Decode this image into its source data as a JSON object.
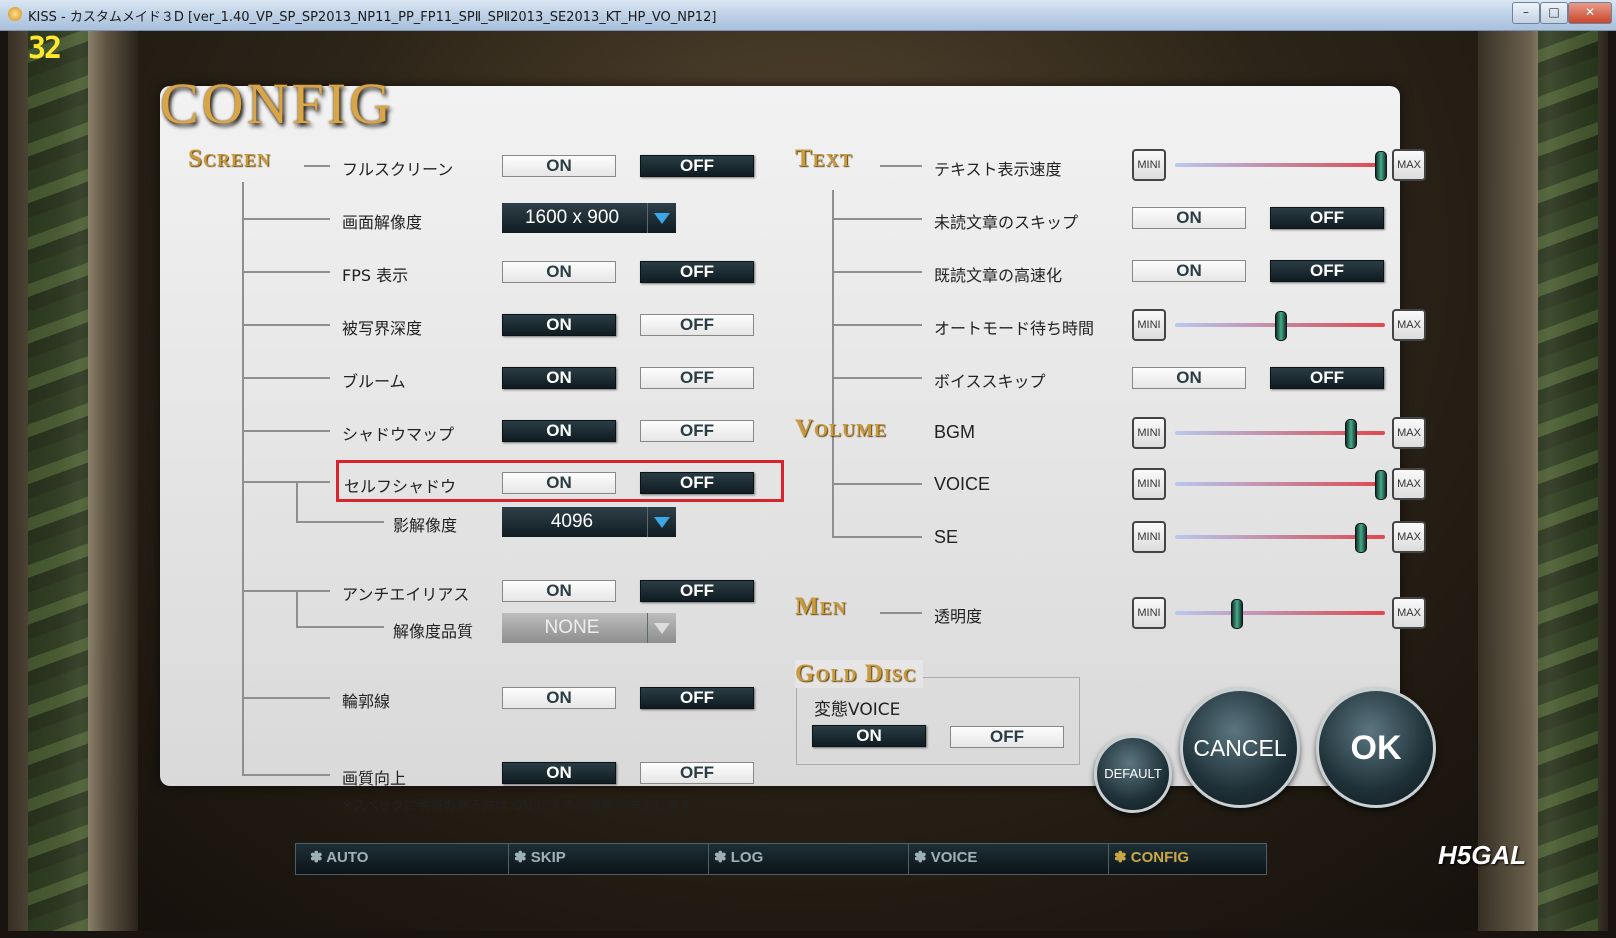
{
  "window": {
    "title": "KISS - カスタムメイド３D [ver_1.40_VP_SP_SP2013_NP11_PP_FP11_SPⅡ_SPⅡ2013_SE2013_KT_HP_VO_NP12]"
  },
  "fps": "32",
  "config_title": "CONFIG",
  "screen": {
    "section": "Screen",
    "fullscreen": {
      "label": "フルスクリーン",
      "on": "ON",
      "off": "OFF"
    },
    "resolution": {
      "label": "画面解像度",
      "value": "1600 x 900"
    },
    "fps_display": {
      "label": "FPS 表示",
      "on": "ON",
      "off": "OFF"
    },
    "depth_of_field": {
      "label": "被写界深度",
      "on": "ON",
      "off": "OFF"
    },
    "bloom": {
      "label": "ブルーム",
      "on": "ON",
      "off": "OFF"
    },
    "shadow_map": {
      "label": "シャドウマップ",
      "on": "ON",
      "off": "OFF"
    },
    "self_shadow": {
      "label": "セルフシャドウ",
      "on": "ON",
      "off": "OFF"
    },
    "shadow_resolution": {
      "label": "影解像度",
      "value": "4096"
    },
    "antialias": {
      "label": "アンチエイリアス",
      "on": "ON",
      "off": "OFF"
    },
    "aa_quality": {
      "label": "解像度品質",
      "value": "NONE"
    },
    "outline": {
      "label": "輪郭線",
      "on": "ON",
      "off": "OFF"
    },
    "quality_up": {
      "label": "画質向上",
      "on": "ON",
      "off": "OFF",
      "note": "※スペックに余裕のある方は ON にすると画質が向上します。"
    }
  },
  "text": {
    "section": "Text",
    "speed": {
      "label": "テキスト表示速度",
      "min": "MINI",
      "max": "MAX",
      "level": 1.0
    },
    "skip_unread": {
      "label": "未読文章のスキップ",
      "on": "ON",
      "off": "OFF"
    },
    "fast_read": {
      "label": "既読文章の高速化",
      "on": "ON",
      "off": "OFF"
    },
    "auto_wait": {
      "label": "オートモード待ち時間",
      "min": "MINI",
      "max": "MAX",
      "level": 0.5
    },
    "voice_skip": {
      "label": "ボイススキップ",
      "on": "ON",
      "off": "OFF"
    }
  },
  "volume": {
    "section": "Volume",
    "bgm": {
      "label": "BGM",
      "min": "MINI",
      "max": "MAX",
      "level": 0.85
    },
    "voice": {
      "label": "VOICE",
      "min": "MINI",
      "max": "MAX",
      "level": 1.0
    },
    "se": {
      "label": "SE",
      "min": "MINI",
      "max": "MAX",
      "level": 0.9
    }
  },
  "men": {
    "section": "Men",
    "transparency": {
      "label": "透明度",
      "min": "MINI",
      "max": "MAX",
      "level": 0.28
    }
  },
  "gold_disc": {
    "section": "Gold Disc",
    "hentai_voice": {
      "label": "変態VOICE",
      "on": "ON",
      "off": "OFF"
    }
  },
  "buttons": {
    "default": "DEFAULT",
    "cancel": "CANCEL",
    "ok": "OK"
  },
  "bottom_bar": {
    "items": [
      "AUTO",
      "SKIP",
      "LOG",
      "VOICE",
      "CONFIG"
    ]
  },
  "logo": "H5GAL",
  "colors": {
    "highlight": "#d9232d",
    "gold": "#c89a3d",
    "button_dark": "#1f3138"
  }
}
